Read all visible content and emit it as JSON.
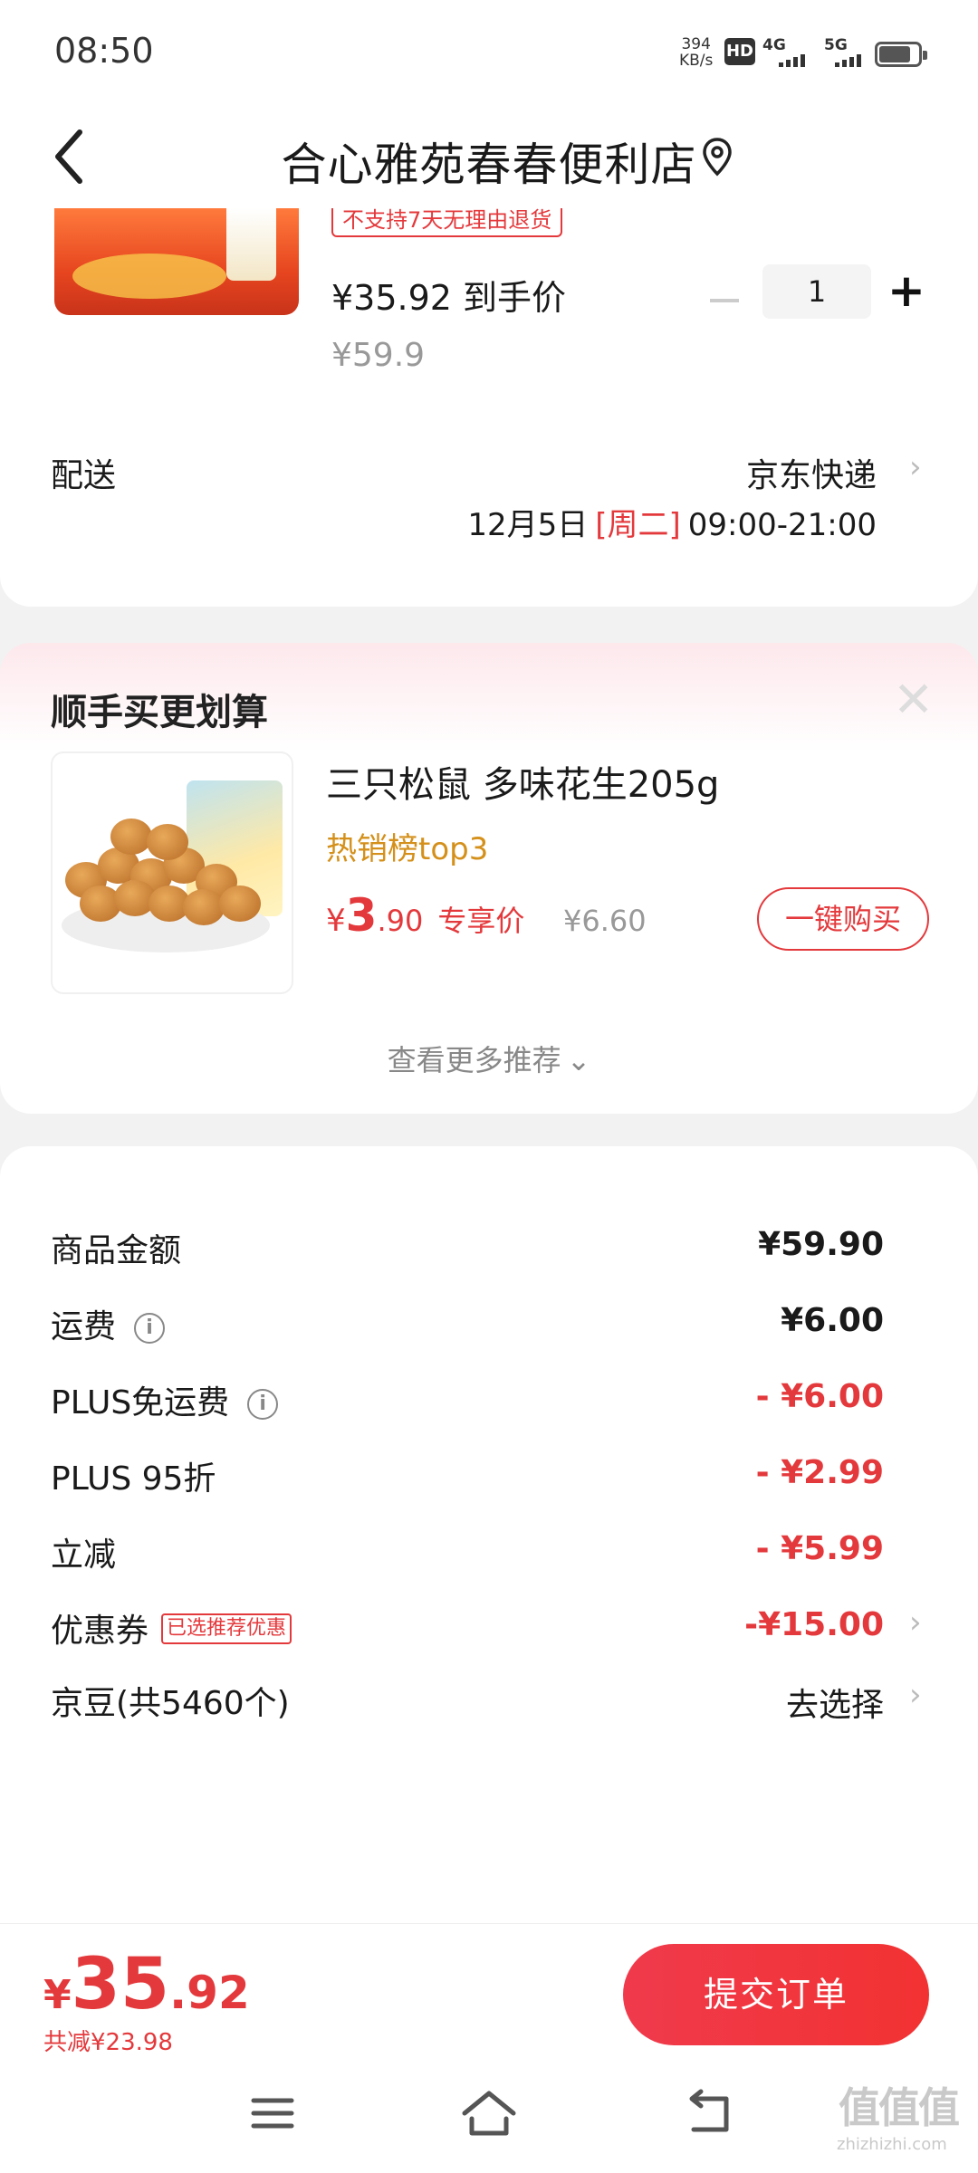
{
  "status_bar": {
    "time": "08:50",
    "net_speed": "394",
    "net_unit": "KB/s",
    "hd": "HD",
    "sig1": "4G",
    "sig2": "5G"
  },
  "header": {
    "title": "合心雅苑春春便利店"
  },
  "product": {
    "return_tag": "不支持7天无理由退货",
    "price": "¥35.92 到手价",
    "original_price": "¥59.9",
    "quantity": "1"
  },
  "delivery": {
    "label": "配送",
    "carrier": "京东快递",
    "date": "12月5日",
    "weekday": "[周二]",
    "time_range": "09:00-21:00"
  },
  "recommend": {
    "title": "顺手买更划算",
    "item_name": "三只松鼠 多味花生205g",
    "rank": "热销榜top3",
    "price_symbol": "¥",
    "price_int": "3",
    "price_dec": ".90",
    "price_label": "专享价",
    "original_price": "¥6.60",
    "buy_button": "一键购买",
    "more": "查看更多推荐"
  },
  "summary": {
    "rows": [
      {
        "label": "商品金额",
        "value": "¥59.90"
      },
      {
        "label": "运费",
        "value": "¥6.00"
      },
      {
        "label": "PLUS免运费",
        "value": "- ¥6.00"
      },
      {
        "label": "PLUS 95折",
        "value": "- ¥2.99"
      },
      {
        "label": "立减",
        "value": "- ¥5.99"
      },
      {
        "label": "优惠券",
        "tag": "已选推荐优惠",
        "value": "-¥15.00"
      },
      {
        "label": "京豆(共5460个)",
        "value": "去选择"
      }
    ]
  },
  "bottom": {
    "currency": "¥",
    "total_int": "35",
    "total_dec": ".92",
    "saved": "共减¥23.98",
    "submit": "提交订单"
  },
  "watermark": {
    "main": "值值值",
    "sub": "zhizhizhi.com"
  },
  "colors": {
    "accent": "#e4393c",
    "rank": "#d4901a",
    "button": "#f03a4c"
  }
}
